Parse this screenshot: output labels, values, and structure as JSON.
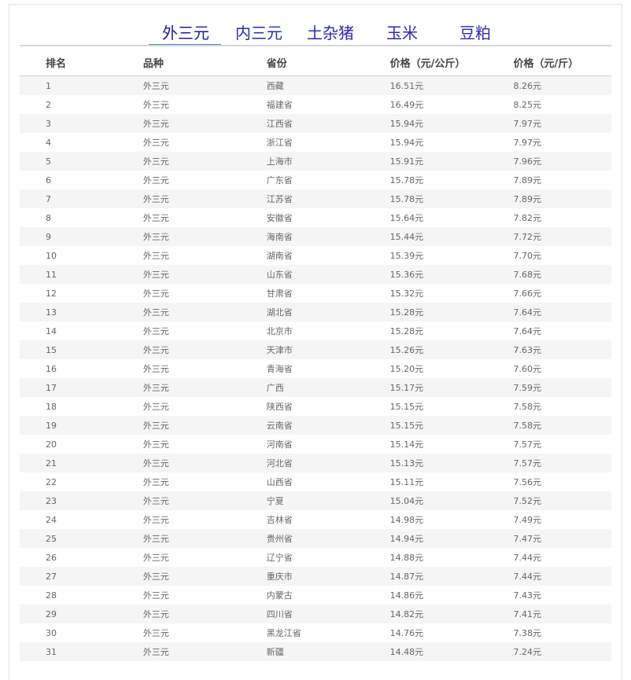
{
  "tabs": [
    {
      "label": "外三元",
      "active": true
    },
    {
      "label": "内三元",
      "active": false
    },
    {
      "label": "土杂猪",
      "active": false
    },
    {
      "label": "玉米",
      "active": false
    },
    {
      "label": "豆粕",
      "active": false
    }
  ],
  "table": {
    "headers": {
      "rank": "排名",
      "variety": "品种",
      "province": "省份",
      "price_kg": "价格（元/公斤）",
      "price_jin": "价格（元/斤）"
    },
    "rows": [
      {
        "rank": "1",
        "variety": "外三元",
        "province": "西藏",
        "price_kg": "16.51元",
        "price_jin": "8.26元"
      },
      {
        "rank": "2",
        "variety": "外三元",
        "province": "福建省",
        "price_kg": "16.49元",
        "price_jin": "8.25元"
      },
      {
        "rank": "3",
        "variety": "外三元",
        "province": "江西省",
        "price_kg": "15.94元",
        "price_jin": "7.97元"
      },
      {
        "rank": "4",
        "variety": "外三元",
        "province": "浙江省",
        "price_kg": "15.94元",
        "price_jin": "7.97元"
      },
      {
        "rank": "5",
        "variety": "外三元",
        "province": "上海市",
        "price_kg": "15.91元",
        "price_jin": "7.96元"
      },
      {
        "rank": "6",
        "variety": "外三元",
        "province": "广东省",
        "price_kg": "15.78元",
        "price_jin": "7.89元"
      },
      {
        "rank": "7",
        "variety": "外三元",
        "province": "江苏省",
        "price_kg": "15.78元",
        "price_jin": "7.89元"
      },
      {
        "rank": "8",
        "variety": "外三元",
        "province": "安徽省",
        "price_kg": "15.64元",
        "price_jin": "7.82元"
      },
      {
        "rank": "9",
        "variety": "外三元",
        "province": "海南省",
        "price_kg": "15.44元",
        "price_jin": "7.72元"
      },
      {
        "rank": "10",
        "variety": "外三元",
        "province": "湖南省",
        "price_kg": "15.39元",
        "price_jin": "7.70元"
      },
      {
        "rank": "11",
        "variety": "外三元",
        "province": "山东省",
        "price_kg": "15.36元",
        "price_jin": "7.68元"
      },
      {
        "rank": "12",
        "variety": "外三元",
        "province": "甘肃省",
        "price_kg": "15.32元",
        "price_jin": "7.66元"
      },
      {
        "rank": "13",
        "variety": "外三元",
        "province": "湖北省",
        "price_kg": "15.28元",
        "price_jin": "7.64元"
      },
      {
        "rank": "14",
        "variety": "外三元",
        "province": "北京市",
        "price_kg": "15.28元",
        "price_jin": "7.64元"
      },
      {
        "rank": "15",
        "variety": "外三元",
        "province": "天津市",
        "price_kg": "15.26元",
        "price_jin": "7.63元"
      },
      {
        "rank": "16",
        "variety": "外三元",
        "province": "青海省",
        "price_kg": "15.20元",
        "price_jin": "7.60元"
      },
      {
        "rank": "17",
        "variety": "外三元",
        "province": "广西",
        "price_kg": "15.17元",
        "price_jin": "7.59元"
      },
      {
        "rank": "18",
        "variety": "外三元",
        "province": "陕西省",
        "price_kg": "15.15元",
        "price_jin": "7.58元"
      },
      {
        "rank": "19",
        "variety": "外三元",
        "province": "云南省",
        "price_kg": "15.15元",
        "price_jin": "7.58元"
      },
      {
        "rank": "20",
        "variety": "外三元",
        "province": "河南省",
        "price_kg": "15.14元",
        "price_jin": "7.57元"
      },
      {
        "rank": "21",
        "variety": "外三元",
        "province": "河北省",
        "price_kg": "15.13元",
        "price_jin": "7.57元"
      },
      {
        "rank": "22",
        "variety": "外三元",
        "province": "山西省",
        "price_kg": "15.11元",
        "price_jin": "7.56元"
      },
      {
        "rank": "23",
        "variety": "外三元",
        "province": "宁夏",
        "price_kg": "15.04元",
        "price_jin": "7.52元"
      },
      {
        "rank": "24",
        "variety": "外三元",
        "province": "吉林省",
        "price_kg": "14.98元",
        "price_jin": "7.49元"
      },
      {
        "rank": "25",
        "variety": "外三元",
        "province": "贵州省",
        "price_kg": "14.94元",
        "price_jin": "7.47元"
      },
      {
        "rank": "26",
        "variety": "外三元",
        "province": "辽宁省",
        "price_kg": "14.88元",
        "price_jin": "7.44元"
      },
      {
        "rank": "27",
        "variety": "外三元",
        "province": "重庆市",
        "price_kg": "14.87元",
        "price_jin": "7.44元"
      },
      {
        "rank": "28",
        "variety": "外三元",
        "province": "内蒙古",
        "price_kg": "14.86元",
        "price_jin": "7.43元"
      },
      {
        "rank": "29",
        "variety": "外三元",
        "province": "四川省",
        "price_kg": "14.82元",
        "price_jin": "7.41元"
      },
      {
        "rank": "30",
        "variety": "外三元",
        "province": "黑龙江省",
        "price_kg": "14.76元",
        "price_jin": "7.38元"
      },
      {
        "rank": "31",
        "variety": "外三元",
        "province": "新疆",
        "price_kg": "14.48元",
        "price_jin": "7.24元"
      }
    ]
  }
}
